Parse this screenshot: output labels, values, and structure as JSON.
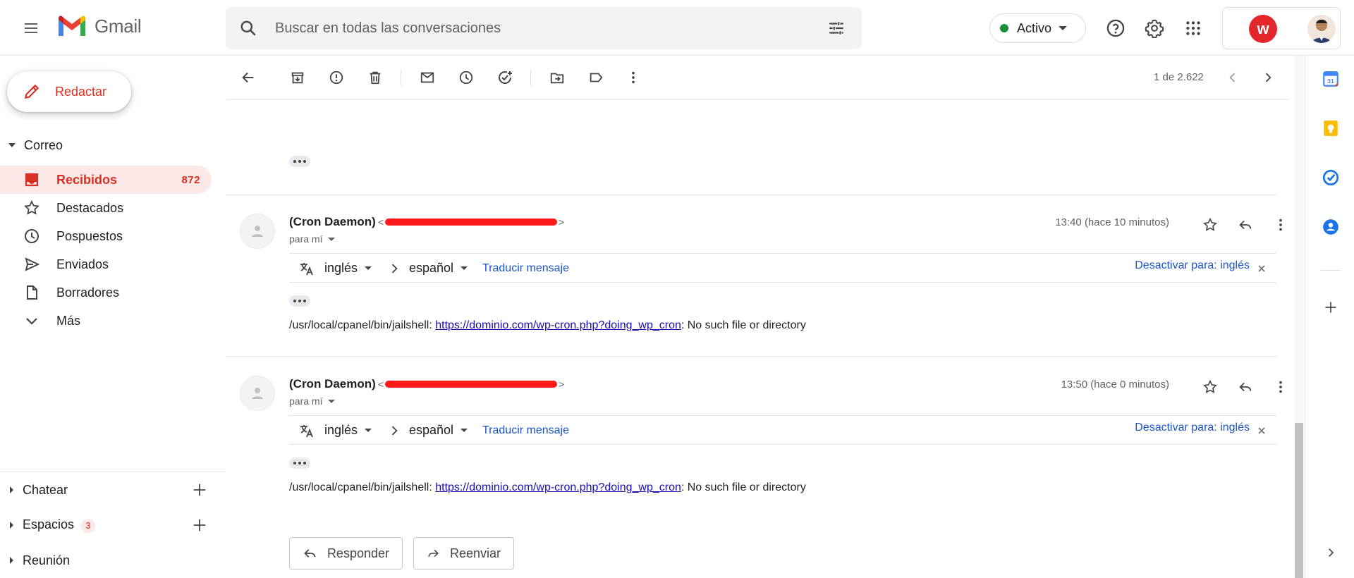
{
  "app": {
    "name": "Gmail"
  },
  "search": {
    "placeholder": "Buscar en todas las conversaciones"
  },
  "status": {
    "label": "Activo",
    "color": "#1e8e3e"
  },
  "account": {
    "org_logo_letter": "w"
  },
  "sidebar": {
    "compose_label": "Redactar",
    "section_label": "Correo",
    "items": [
      {
        "label": "Recibidos",
        "count": "872",
        "icon": "inbox-icon",
        "active": true
      },
      {
        "label": "Destacados",
        "icon": "star-icon"
      },
      {
        "label": "Pospuestos",
        "icon": "clock-icon"
      },
      {
        "label": "Enviados",
        "icon": "send-icon"
      },
      {
        "label": "Borradores",
        "icon": "draft-icon"
      },
      {
        "label": "Más",
        "icon": "chevron-down-icon"
      }
    ],
    "bottom_sections": [
      {
        "label": "Chatear"
      },
      {
        "label": "Espacios",
        "badge": "3"
      },
      {
        "label": "Reunión"
      }
    ]
  },
  "toolbar": {
    "pager": "1 de 2.622"
  },
  "messages": [
    {
      "sender": "(Cron Daemon)",
      "to_label": "para mí",
      "time": "13:40 (hace 10 minutos)",
      "translate": {
        "from": "inglés",
        "to": "español",
        "action": "Traducir mensaje",
        "disable": "Desactivar para: inglés"
      },
      "body_prefix": "/usr/local/cpanel/bin/jailshell: ",
      "body_link": "https://dominio.com/wp-cron.php?doing_wp_cron",
      "body_suffix": ": No such file or directory"
    },
    {
      "sender": "(Cron Daemon)",
      "to_label": "para mí",
      "time": "13:50 (hace 0 minutos)",
      "translate": {
        "from": "inglés",
        "to": "español",
        "action": "Traducir mensaje",
        "disable": "Desactivar para: inglés"
      },
      "body_prefix": "/usr/local/cpanel/bin/jailshell: ",
      "body_link": "https://dominio.com/wp-cron.php?doing_wp_cron",
      "body_suffix": ": No such file or directory"
    }
  ],
  "actions": {
    "reply": "Responder",
    "forward": "Reenviar"
  },
  "colors": {
    "accent_red": "#d93025",
    "link_blue": "#1a56c8",
    "active_bg": "#fce8e6"
  }
}
